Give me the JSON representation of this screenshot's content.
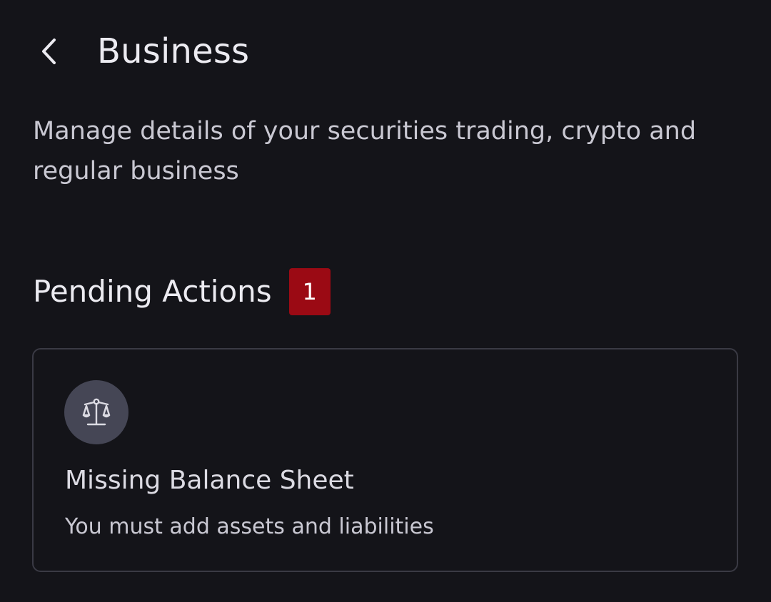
{
  "header": {
    "back_icon": "chevron-left-icon",
    "title": "Business"
  },
  "description": "Manage details of your securities trading, crypto and regular business",
  "pending": {
    "title": "Pending Actions",
    "count": "1",
    "badge_color": "#9b0a14",
    "items": [
      {
        "icon": "balance-scale-icon",
        "title": "Missing Balance Sheet",
        "subtitle": "You must add assets and liabilities"
      }
    ]
  },
  "colors": {
    "background": "#141419",
    "text_primary": "#ecebf1",
    "text_secondary": "#c9c8d2",
    "card_border": "#3a3a44",
    "icon_circle": "#454655"
  }
}
